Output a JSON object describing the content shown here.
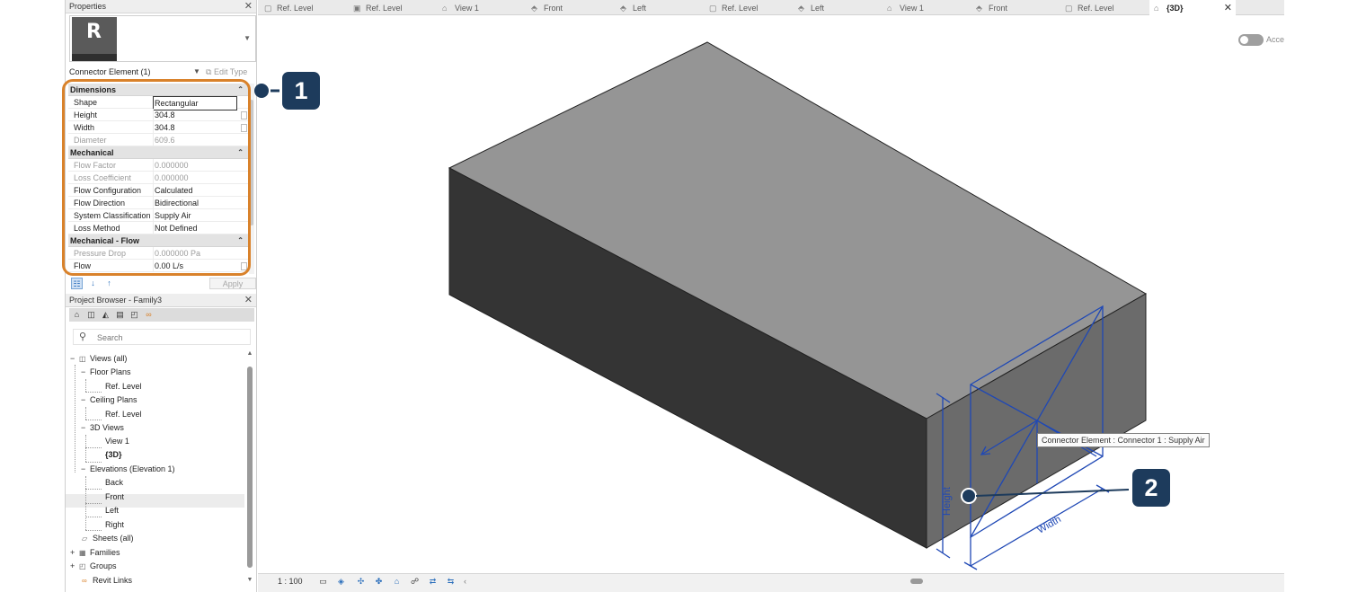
{
  "properties": {
    "title": "Properties",
    "type_logo_letter": "R",
    "selector": "Connector Element (1)",
    "edit_type": "Edit Type",
    "groups": [
      {
        "name": "Dimensions",
        "rows": [
          {
            "name": "Shape",
            "value": "Rectangular",
            "editable": true
          },
          {
            "name": "Height",
            "value": "304.8",
            "editable": true
          },
          {
            "name": "Width",
            "value": "304.8",
            "editable": true
          },
          {
            "name": "Diameter",
            "value": "609.6",
            "editable": false
          }
        ]
      },
      {
        "name": "Mechanical",
        "rows": [
          {
            "name": "Flow Factor",
            "value": "0.000000",
            "editable": false
          },
          {
            "name": "Loss Coefficient",
            "value": "0.000000",
            "editable": false
          },
          {
            "name": "Flow Configuration",
            "value": "Calculated",
            "editable": true
          },
          {
            "name": "Flow Direction",
            "value": "Bidirectional",
            "editable": true
          },
          {
            "name": "System Classification",
            "value": "Supply Air",
            "editable": true
          },
          {
            "name": "Loss Method",
            "value": "Not Defined",
            "editable": true
          }
        ]
      },
      {
        "name": "Mechanical - Flow",
        "rows": [
          {
            "name": "Pressure Drop",
            "value": "0.000000 Pa",
            "editable": false
          },
          {
            "name": "Flow",
            "value": "0.00 L/s",
            "editable": true
          }
        ]
      }
    ],
    "apply_label": "Apply"
  },
  "browser": {
    "title": "Project Browser - Family3",
    "search_placeholder": "Search",
    "tree": {
      "views_all": "Views (all)",
      "floor_plans": "Floor Plans",
      "floor_ref": "Ref. Level",
      "ceiling_plans": "Ceiling Plans",
      "ceiling_ref": "Ref. Level",
      "views_3d": "3D Views",
      "view1": "View 1",
      "view3d": "{3D}",
      "elevations": "Elevations (Elevation 1)",
      "back": "Back",
      "front": "Front",
      "left": "Left",
      "right": "Right",
      "sheets": "Sheets (all)",
      "families": "Families",
      "groups": "Groups",
      "revit_links": "Revit Links"
    }
  },
  "tabs": [
    {
      "label": "Ref. Level",
      "icon": "ceiling-plan-icon"
    },
    {
      "label": "Ref. Level",
      "icon": "floor-plan-icon"
    },
    {
      "label": "View 1",
      "icon": "3d-view-icon"
    },
    {
      "label": "Front",
      "icon": "elevation-icon"
    },
    {
      "label": "Left",
      "icon": "elevation-icon"
    },
    {
      "label": "Ref. Level",
      "icon": "ceiling-plan-icon"
    },
    {
      "label": "Left",
      "icon": "elevation-icon"
    },
    {
      "label": "View 1",
      "icon": "3d-view-icon"
    },
    {
      "label": "Front",
      "icon": "elevation-icon"
    },
    {
      "label": "Ref. Level",
      "icon": "ceiling-plan-icon"
    },
    {
      "label": "{3D}",
      "icon": "3d-view-icon",
      "active": true
    }
  ],
  "viewport": {
    "toggle_label": "Acce",
    "tooltip": "Connector Element : Connector 1 : Supply Air",
    "height_label": "Height",
    "width_label": "Width"
  },
  "statusbar": {
    "scale": "1 : 100"
  },
  "callouts": {
    "one": "1",
    "two": "2"
  },
  "colors": {
    "accent_orange": "#d9822b",
    "badge_navy": "#1d3b5c",
    "connector_blue": "#1f48b5",
    "box_top": "#959595",
    "box_left": "#343434",
    "box_right": "#6b6b6b"
  }
}
